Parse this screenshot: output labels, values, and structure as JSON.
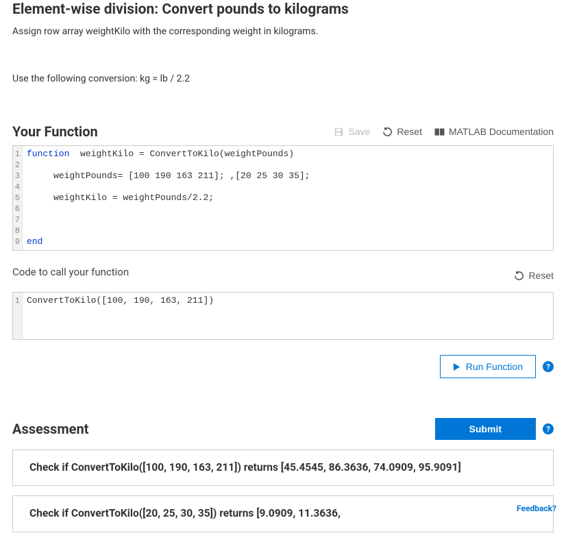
{
  "title": "Element-wise division: Convert pounds to kilograms",
  "desc1": "Assign row array weightKilo with the corresponding weight in kilograms.",
  "desc2": "Use the following conversion: kg = lb / 2.2",
  "yourFunction": {
    "heading": "Your Function",
    "save": "Save",
    "reset": "Reset",
    "docs": "MATLAB Documentation",
    "code": {
      "ln1": {
        "kw": "function",
        "rest": "  weightKilo = ConvertToKilo(weightPounds)"
      },
      "ln3": "     weightPounds= [100 190 163 211]; ,[20 25 30 35];",
      "ln5": "     weightKilo = weightPounds/2.2;",
      "ln9": {
        "kw": "end"
      }
    },
    "gutter": [
      "1",
      "2",
      "3",
      "4",
      "5",
      "6",
      "7",
      "8",
      "9"
    ]
  },
  "callFn": {
    "heading": "Code to call your function",
    "reset": "Reset",
    "code": "ConvertToKilo([100, 190, 163, 211])",
    "gutter": [
      "1"
    ]
  },
  "runBtn": "Run Function",
  "assessment": {
    "heading": "Assessment",
    "submit": "Submit",
    "checks": [
      "Check if ConvertToKilo([100, 190, 163, 211]) returns [45.4545, 86.3636, 74.0909, 95.9091]",
      "Check if ConvertToKilo([20, 25, 30, 35]) returns [9.0909, 11.3636,"
    ]
  },
  "feedback": "Feedback?"
}
